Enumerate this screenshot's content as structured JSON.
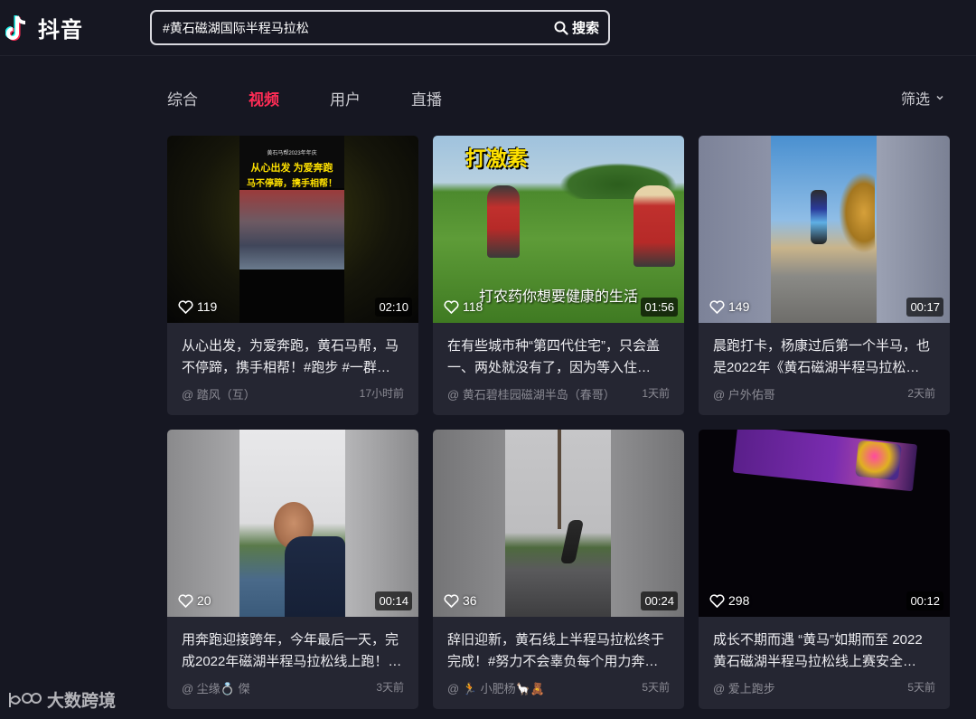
{
  "app": {
    "name": "抖音"
  },
  "search": {
    "value": "#黄石磁湖国际半程马拉松",
    "button_label": "搜索"
  },
  "tabs": [
    {
      "label": "综合",
      "active": false
    },
    {
      "label": "视频",
      "active": true
    },
    {
      "label": "用户",
      "active": false
    },
    {
      "label": "直播",
      "active": false
    }
  ],
  "filter": {
    "label": "筛选"
  },
  "colors": {
    "accent": "#fe2c55",
    "background": "#161722",
    "card": "#252632"
  },
  "videos": [
    {
      "likes": "119",
      "duration": "02:10",
      "description": "从心出发，为爱奔跑，黄石马帮，马不停蹄，携手相帮！#跑步 #一群…",
      "author": "@ 踏风（互）",
      "time": "17小时前",
      "overlay": {
        "header": "黄石马帮2023年年庆",
        "line1": "从心出发 为爱奔跑",
        "line2": "马不停蹄，携手相帮！"
      }
    },
    {
      "likes": "118",
      "duration": "01:56",
      "description": "在有些城市种“第四代住宅”，只会盖一、两处就没有了，因为等入住…",
      "author": "@ 黄石碧桂园磁湖半岛（春哥）",
      "time": "1天前",
      "overlay": {
        "title": "打激素",
        "subtitle": "打农药你想要健康的生活"
      }
    },
    {
      "likes": "149",
      "duration": "00:17",
      "description": "晨跑打卡，杨康过后第一个半马，也是2022年《黄石磁湖半程马拉松…",
      "author": "@ 户外佑哥",
      "time": "2天前"
    },
    {
      "likes": "20",
      "duration": "00:14",
      "description": "用奔跑迎接跨年，今年最后一天，完成2022年磁湖半程马拉松线上跑！…",
      "author": "@ 尘缘💍 傑",
      "time": "3天前"
    },
    {
      "likes": "36",
      "duration": "00:24",
      "description": "辞旧迎新，黄石线上半程马拉松终于完成！#努力不会辜负每个用力奔…",
      "author": "@ 🏃 小肥杨🦙🧸",
      "time": "5天前"
    },
    {
      "likes": "298",
      "duration": "00:12",
      "description": "成长不期而遇 “黄马”如期而至 2022黄石磁湖半程马拉松线上赛安全…",
      "author": "@ 爱上跑步",
      "time": "5天前"
    }
  ],
  "watermark": {
    "text": "大数跨境"
  }
}
